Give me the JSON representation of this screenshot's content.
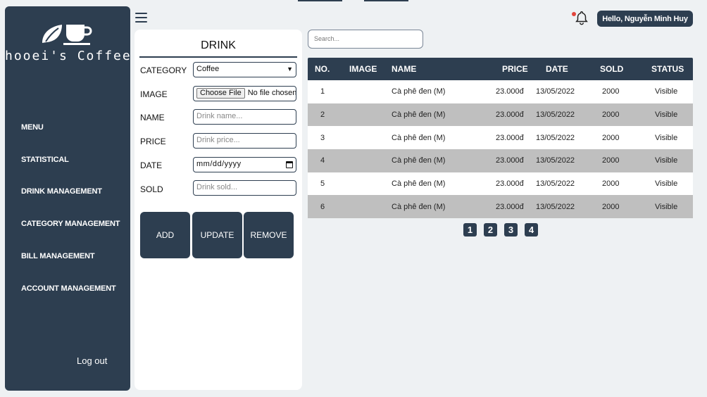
{
  "sidebar": {
    "brand": "hooei's Coffee",
    "items": [
      {
        "label": "MENU"
      },
      {
        "label": "STATISTICAL"
      },
      {
        "label": "DRINK MANAGEMENT"
      },
      {
        "label": "CATEGORY MANAGEMENT"
      },
      {
        "label": "BILL MANAGEMENT"
      },
      {
        "label": "ACCOUNT MANAGEMENT"
      }
    ],
    "logout": "Log out"
  },
  "form": {
    "title": "DRINK",
    "category_label": "CATEGORY",
    "category_value": "Coffee",
    "image_label": "IMAGE",
    "image_button": "Choose File",
    "image_status": "No file chosen",
    "name_label": "NAME",
    "name_placeholder": "Drink name...",
    "price_label": "PRICE",
    "price_placeholder": "Drink price...",
    "date_label": "DATE",
    "date_placeholder": "mm/dd/yyyy",
    "sold_label": "SOLD",
    "sold_placeholder": "Drink sold...",
    "add": "ADD",
    "update": "UPDATE",
    "remove": "REMOVE"
  },
  "search": {
    "placeholder": "Search..."
  },
  "header": {
    "greeting": "Hello, Nguyễn Minh Huy"
  },
  "table": {
    "columns": [
      "NO.",
      "IMAGE",
      "NAME",
      "PRICE",
      "DATE",
      "SOLD",
      "STATUS"
    ],
    "rows": [
      {
        "no": "1",
        "image": "",
        "name": "Cà phê đen (M)",
        "price": "23.000đ",
        "date": "13/05/2022",
        "sold": "2000",
        "status": "Visible"
      },
      {
        "no": "2",
        "image": "",
        "name": "Cà phê đen (M)",
        "price": "23.000đ",
        "date": "13/05/2022",
        "sold": "2000",
        "status": "Visible"
      },
      {
        "no": "3",
        "image": "",
        "name": "Cà phê đen (M)",
        "price": "23.000đ",
        "date": "13/05/2022",
        "sold": "2000",
        "status": "Visible"
      },
      {
        "no": "4",
        "image": "",
        "name": "Cà phê đen (M)",
        "price": "23.000đ",
        "date": "13/05/2022",
        "sold": "2000",
        "status": "Visible"
      },
      {
        "no": "5",
        "image": "",
        "name": "Cà phê đen (M)",
        "price": "23.000đ",
        "date": "13/05/2022",
        "sold": "2000",
        "status": "Visible"
      },
      {
        "no": "6",
        "image": "",
        "name": "Cà phê đen (M)",
        "price": "23.000đ",
        "date": "13/05/2022",
        "sold": "2000",
        "status": "Visible"
      }
    ]
  },
  "pagination": [
    "1",
    "2",
    "3",
    "4"
  ],
  "colors": {
    "primary": "#2d3e50",
    "alt_row": "#bfbfbf",
    "notification": "#e2453c"
  }
}
